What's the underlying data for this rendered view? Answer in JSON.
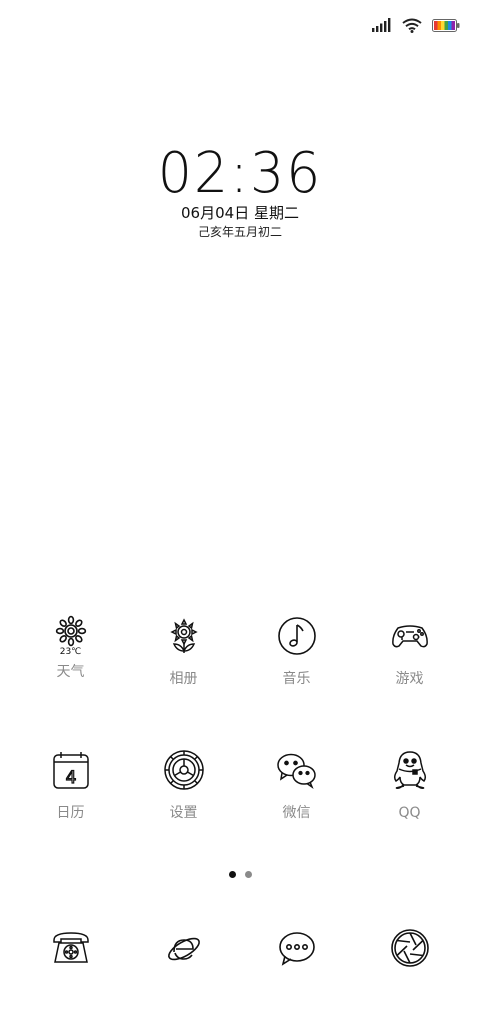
{
  "status_bar": {
    "signal_icon": "signal-icon",
    "wifi_icon": "wifi-icon",
    "battery_icon": "battery-icon"
  },
  "clock": {
    "time": "02:36",
    "date": "06月04日 星期二",
    "lunar": "己亥年五月初二"
  },
  "weather": {
    "temperature": "23℃"
  },
  "apps_row1": [
    {
      "label": "天气",
      "icon": "sun-icon"
    },
    {
      "label": "相册",
      "icon": "flower-icon"
    },
    {
      "label": "音乐",
      "icon": "music-note-icon"
    },
    {
      "label": "游戏",
      "icon": "gamepad-icon"
    }
  ],
  "apps_row2": [
    {
      "label": "日历",
      "icon": "calendar-icon"
    },
    {
      "label": "设置",
      "icon": "gear-icon"
    },
    {
      "label": "微信",
      "icon": "wechat-icon"
    },
    {
      "label": "QQ",
      "icon": "qq-penguin-icon"
    }
  ],
  "calendar_day": "4",
  "page_indicator": {
    "pages": 2,
    "current": 1
  },
  "dock": [
    {
      "icon": "phone-icon"
    },
    {
      "icon": "browser-icon"
    },
    {
      "icon": "messages-icon"
    },
    {
      "icon": "camera-icon"
    }
  ],
  "colors": {
    "background": "#ffffff",
    "icon_stroke": "#111111",
    "label_text": "#8a8a8a"
  }
}
